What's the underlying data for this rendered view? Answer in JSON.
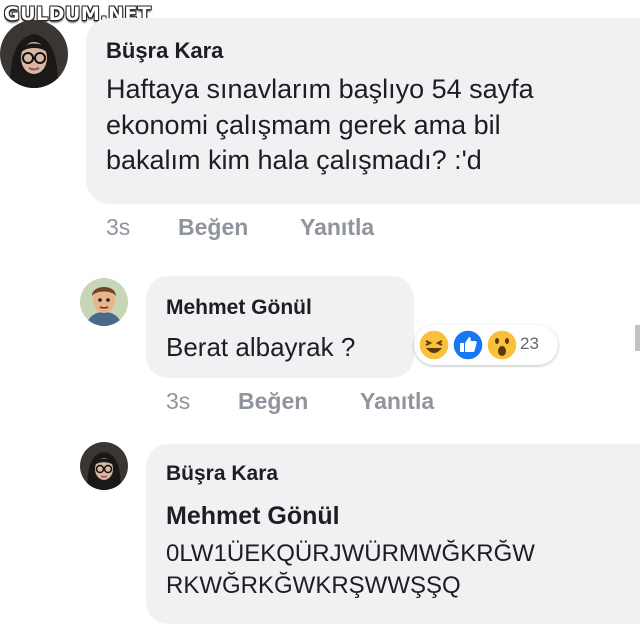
{
  "watermark": "GULDUM.NET",
  "comments": [
    {
      "author": "Büşra Kara",
      "lines": [
        "Haftaya sınavlarım başlıyo 54 sayfa",
        "ekonomi çalışmam gerek ama bil",
        "bakalım kim hala çalışmadı? :'d"
      ],
      "time": "3s",
      "like_label": "Beğen",
      "reply_label": "Yanıtla",
      "avatar_icon": "profile-photo-woman-glasses"
    },
    {
      "author": "Mehmet Gönül",
      "text": "Berat albayrak ?",
      "time": "3s",
      "like_label": "Beğen",
      "reply_label": "Yanıtla",
      "avatar_icon": "profile-photo-cartoon-man",
      "reactions": {
        "icons": [
          "haha-icon",
          "like-icon",
          "wow-icon"
        ],
        "count": "23"
      }
    },
    {
      "author": "Büşra Kara",
      "mention": "Mehmet Gönül",
      "lines": [
        "0LW1ÜEKQÜRJWÜRMWĞKRĞW",
        "RKWĞRKĞWKRŞWWŞŞQ"
      ],
      "avatar_icon": "profile-photo-woman-glasses"
    }
  ],
  "colors": {
    "bubble": "#f0f1f3",
    "text": "#1c1e21",
    "meta": "#90949c",
    "like_blue": "#1877f2",
    "reaction_yellow": "#f7c23a"
  }
}
